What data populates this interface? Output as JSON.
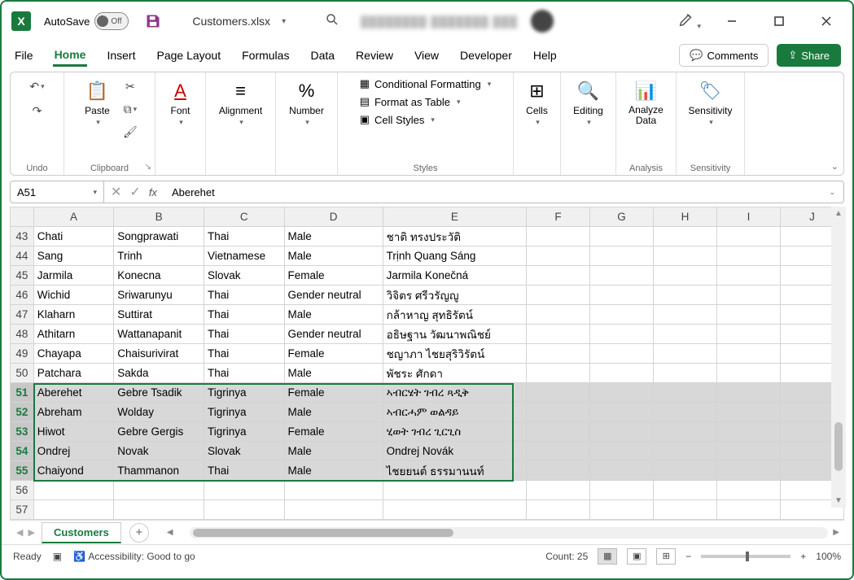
{
  "titlebar": {
    "autosave_label": "AutoSave",
    "autosave_state": "Off",
    "filename": "Customers.xlsx"
  },
  "tabs": {
    "file": "File",
    "home": "Home",
    "insert": "Insert",
    "pagelayout": "Page Layout",
    "formulas": "Formulas",
    "data": "Data",
    "review": "Review",
    "view": "View",
    "developer": "Developer",
    "help": "Help",
    "comments": "Comments",
    "share": "Share"
  },
  "ribbon": {
    "undo": "Undo",
    "clipboard": "Clipboard",
    "paste": "Paste",
    "font": "Font",
    "alignment": "Alignment",
    "number": "Number",
    "cond_fmt": "Conditional Formatting",
    "fmt_table": "Format as Table",
    "cell_styles": "Cell Styles",
    "styles": "Styles",
    "cells": "Cells",
    "editing": "Editing",
    "analyze": "Analyze Data",
    "analysis": "Analysis",
    "sensitivity": "Sensitivity",
    "sensitivity_grp": "Sensitivity"
  },
  "namebox": "A51",
  "formula": "Aberehet",
  "columns": [
    "A",
    "B",
    "C",
    "D",
    "E",
    "F",
    "G",
    "H",
    "I",
    "J"
  ],
  "rows": [
    {
      "n": 43,
      "c": [
        "Chati",
        "Songprawati",
        "Thai",
        "Male",
        "ชาติ ทรงประวัติ"
      ]
    },
    {
      "n": 44,
      "c": [
        "Sang",
        "Trinh",
        "Vietnamese",
        "Male",
        "Trịnh Quang Sáng"
      ]
    },
    {
      "n": 45,
      "c": [
        "Jarmila",
        "Konecna",
        "Slovak",
        "Female",
        "Jarmila Konečná"
      ]
    },
    {
      "n": 46,
      "c": [
        "Wichid",
        "Sriwarunyu",
        "Thai",
        "Gender neutral",
        "วิจิตร ศรีวรัญญู"
      ]
    },
    {
      "n": 47,
      "c": [
        "Klaharn",
        "Suttirat",
        "Thai",
        "Male",
        "กล้าหาญ สุทธิรัตน์"
      ]
    },
    {
      "n": 48,
      "c": [
        "Athitarn",
        "Wattanapanit",
        "Thai",
        "Gender neutral",
        "อธิษฐาน วัฒนาพณิชย์"
      ]
    },
    {
      "n": 49,
      "c": [
        "Chayapa",
        "Chaisurivirat",
        "Thai",
        "Female",
        "ชญาภา ไชยสุริวิรัตน์"
      ]
    },
    {
      "n": 50,
      "c": [
        "Patchara",
        "Sakda",
        "Thai",
        "Male",
        "พัชระ ศักดา"
      ]
    },
    {
      "n": 51,
      "c": [
        "Aberehet",
        "Gebre Tsadik",
        "Tigrinya",
        "Female",
        "ኣብርሄት ገብረ ጻዲቅ"
      ],
      "sel": true
    },
    {
      "n": 52,
      "c": [
        "Abreham",
        "Wolday",
        "Tigrinya",
        "Male",
        "ኣብርሓም ወልዳይ"
      ],
      "sel": true
    },
    {
      "n": 53,
      "c": [
        "Hiwot",
        "Gebre Gergis",
        "Tigrinya",
        "Female",
        "ሂወት ገብረ ጊርጊስ"
      ],
      "sel": true
    },
    {
      "n": 54,
      "c": [
        "Ondrej",
        "Novak",
        "Slovak",
        "Male",
        "Ondrej Novák"
      ],
      "sel": true
    },
    {
      "n": 55,
      "c": [
        "Chaiyond",
        "Thammanon",
        "Thai",
        "Male",
        "ไชยยนต์ ธรรมานนท์"
      ],
      "sel": true
    },
    {
      "n": 56,
      "c": [
        "",
        "",
        "",
        "",
        ""
      ]
    },
    {
      "n": 57,
      "c": [
        "",
        "",
        "",
        "",
        ""
      ]
    }
  ],
  "sheettab": "Customers",
  "status": {
    "ready": "Ready",
    "accessibility": "Accessibility: Good to go",
    "count": "Count: 25",
    "zoom": "100%"
  }
}
